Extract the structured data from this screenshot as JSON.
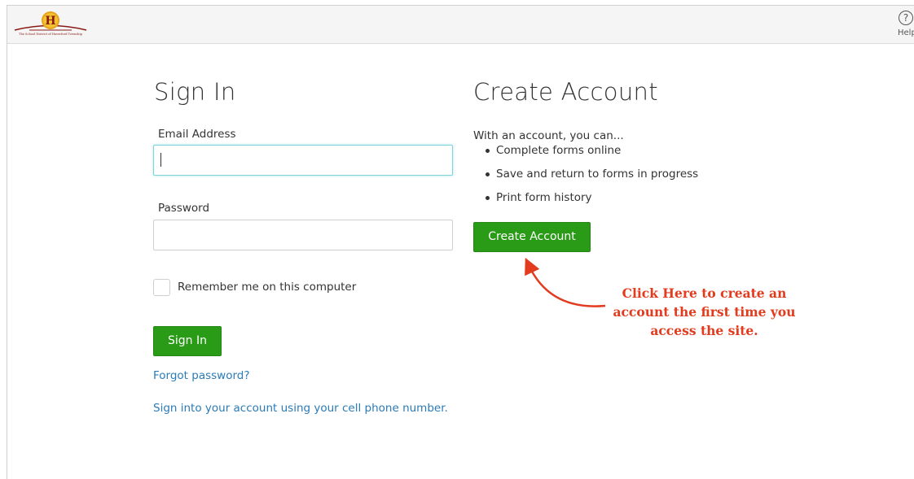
{
  "header": {
    "logo_letter": "H",
    "logo_text": "The School District of Haverford Township",
    "help_label": "Help",
    "help_symbol": "?"
  },
  "sign_in": {
    "title": "Sign In",
    "email_label": "Email Address",
    "email_value": "",
    "password_label": "Password",
    "password_value": "",
    "remember_label": "Remember me on this computer",
    "remember_checked": false,
    "button_label": "Sign In",
    "forgot_link": "Forgot password?",
    "cell_phone_link": "Sign into your account using your cell phone number."
  },
  "create_account": {
    "title": "Create Account",
    "intro": "With an account, you can...",
    "benefits": [
      "Complete forms online",
      "Save and return to forms in progress",
      "Print form history"
    ],
    "button_label": "Create Account"
  },
  "annotation": {
    "line1": "Click Here to create an",
    "line2": "account the first time you",
    "line3": "access the site.",
    "color": "#e23b1d"
  },
  "colors": {
    "primary_button": "#2a9b16",
    "link": "#2a7bb8",
    "focus_border": "#7fd4dc",
    "logo_red": "#8a1a14",
    "logo_gold": "#e8a21a"
  }
}
